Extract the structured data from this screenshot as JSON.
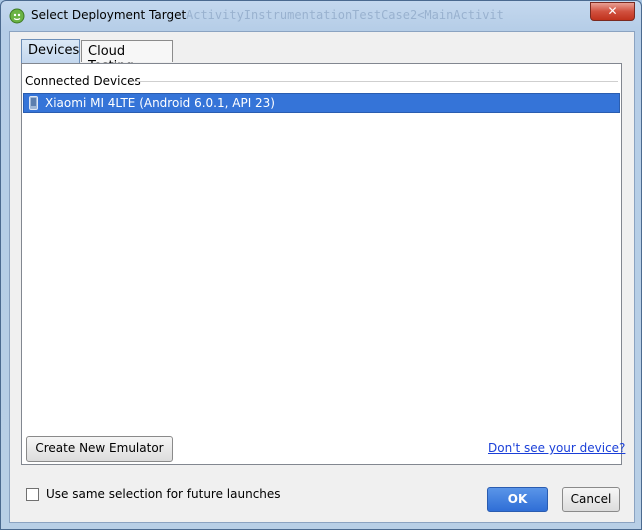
{
  "window": {
    "title": "Select Deployment Target",
    "background_title": "ActivityInstrumentationTestCase2<MainActivit",
    "close_label": "✕"
  },
  "tabs": [
    {
      "label": "Devices",
      "selected": true
    },
    {
      "label": "Cloud Testing",
      "selected": false
    }
  ],
  "devices": {
    "group_label": "Connected Devices",
    "items": [
      {
        "label": "Xiaomi MI 4LTE (Android 6.0.1, API 23)",
        "selected": true,
        "icon": "phone-icon"
      }
    ]
  },
  "actions": {
    "create_emulator_label": "Create New Emulator",
    "help_link": "Don't see your device?",
    "same_selection_label": "Use same selection for future launches",
    "same_selection_checked": false,
    "ok_label": "OK",
    "cancel_label": "Cancel"
  },
  "colors": {
    "selection": "#3574d8",
    "ok_button": "#2f6ed6",
    "link": "#1a3fd8",
    "close_button": "#c0321d"
  }
}
